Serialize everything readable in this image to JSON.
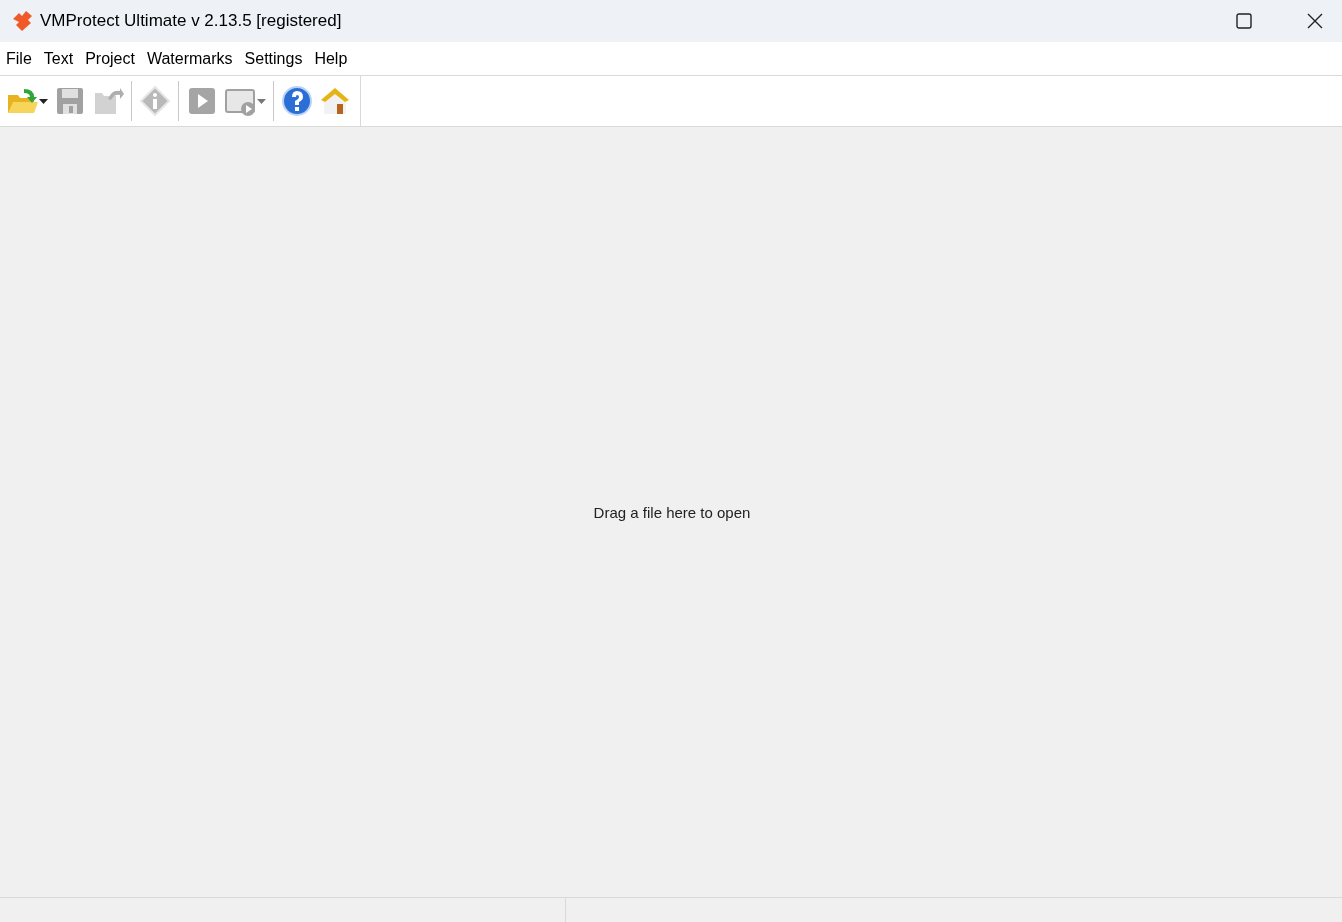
{
  "window": {
    "title": "VMProtect Ultimate v 2.13.5 [registered]"
  },
  "menu": [
    "File",
    "Text",
    "Project",
    "Watermarks",
    "Settings",
    "Help"
  ],
  "toolbar": [
    {
      "kind": "open",
      "disabled": false,
      "dropdown": true
    },
    {
      "kind": "save",
      "disabled": true,
      "dropdown": false
    },
    {
      "kind": "export",
      "disabled": true,
      "dropdown": false
    },
    {
      "kind": "separator"
    },
    {
      "kind": "info",
      "disabled": true,
      "dropdown": false
    },
    {
      "kind": "separator"
    },
    {
      "kind": "run",
      "disabled": true,
      "dropdown": false
    },
    {
      "kind": "run-window",
      "disabled": true,
      "dropdown": true
    },
    {
      "kind": "separator"
    },
    {
      "kind": "help",
      "disabled": false,
      "dropdown": false
    },
    {
      "kind": "home",
      "disabled": false,
      "dropdown": false
    }
  ],
  "workspace": {
    "hint": "Drag a file here to open"
  }
}
